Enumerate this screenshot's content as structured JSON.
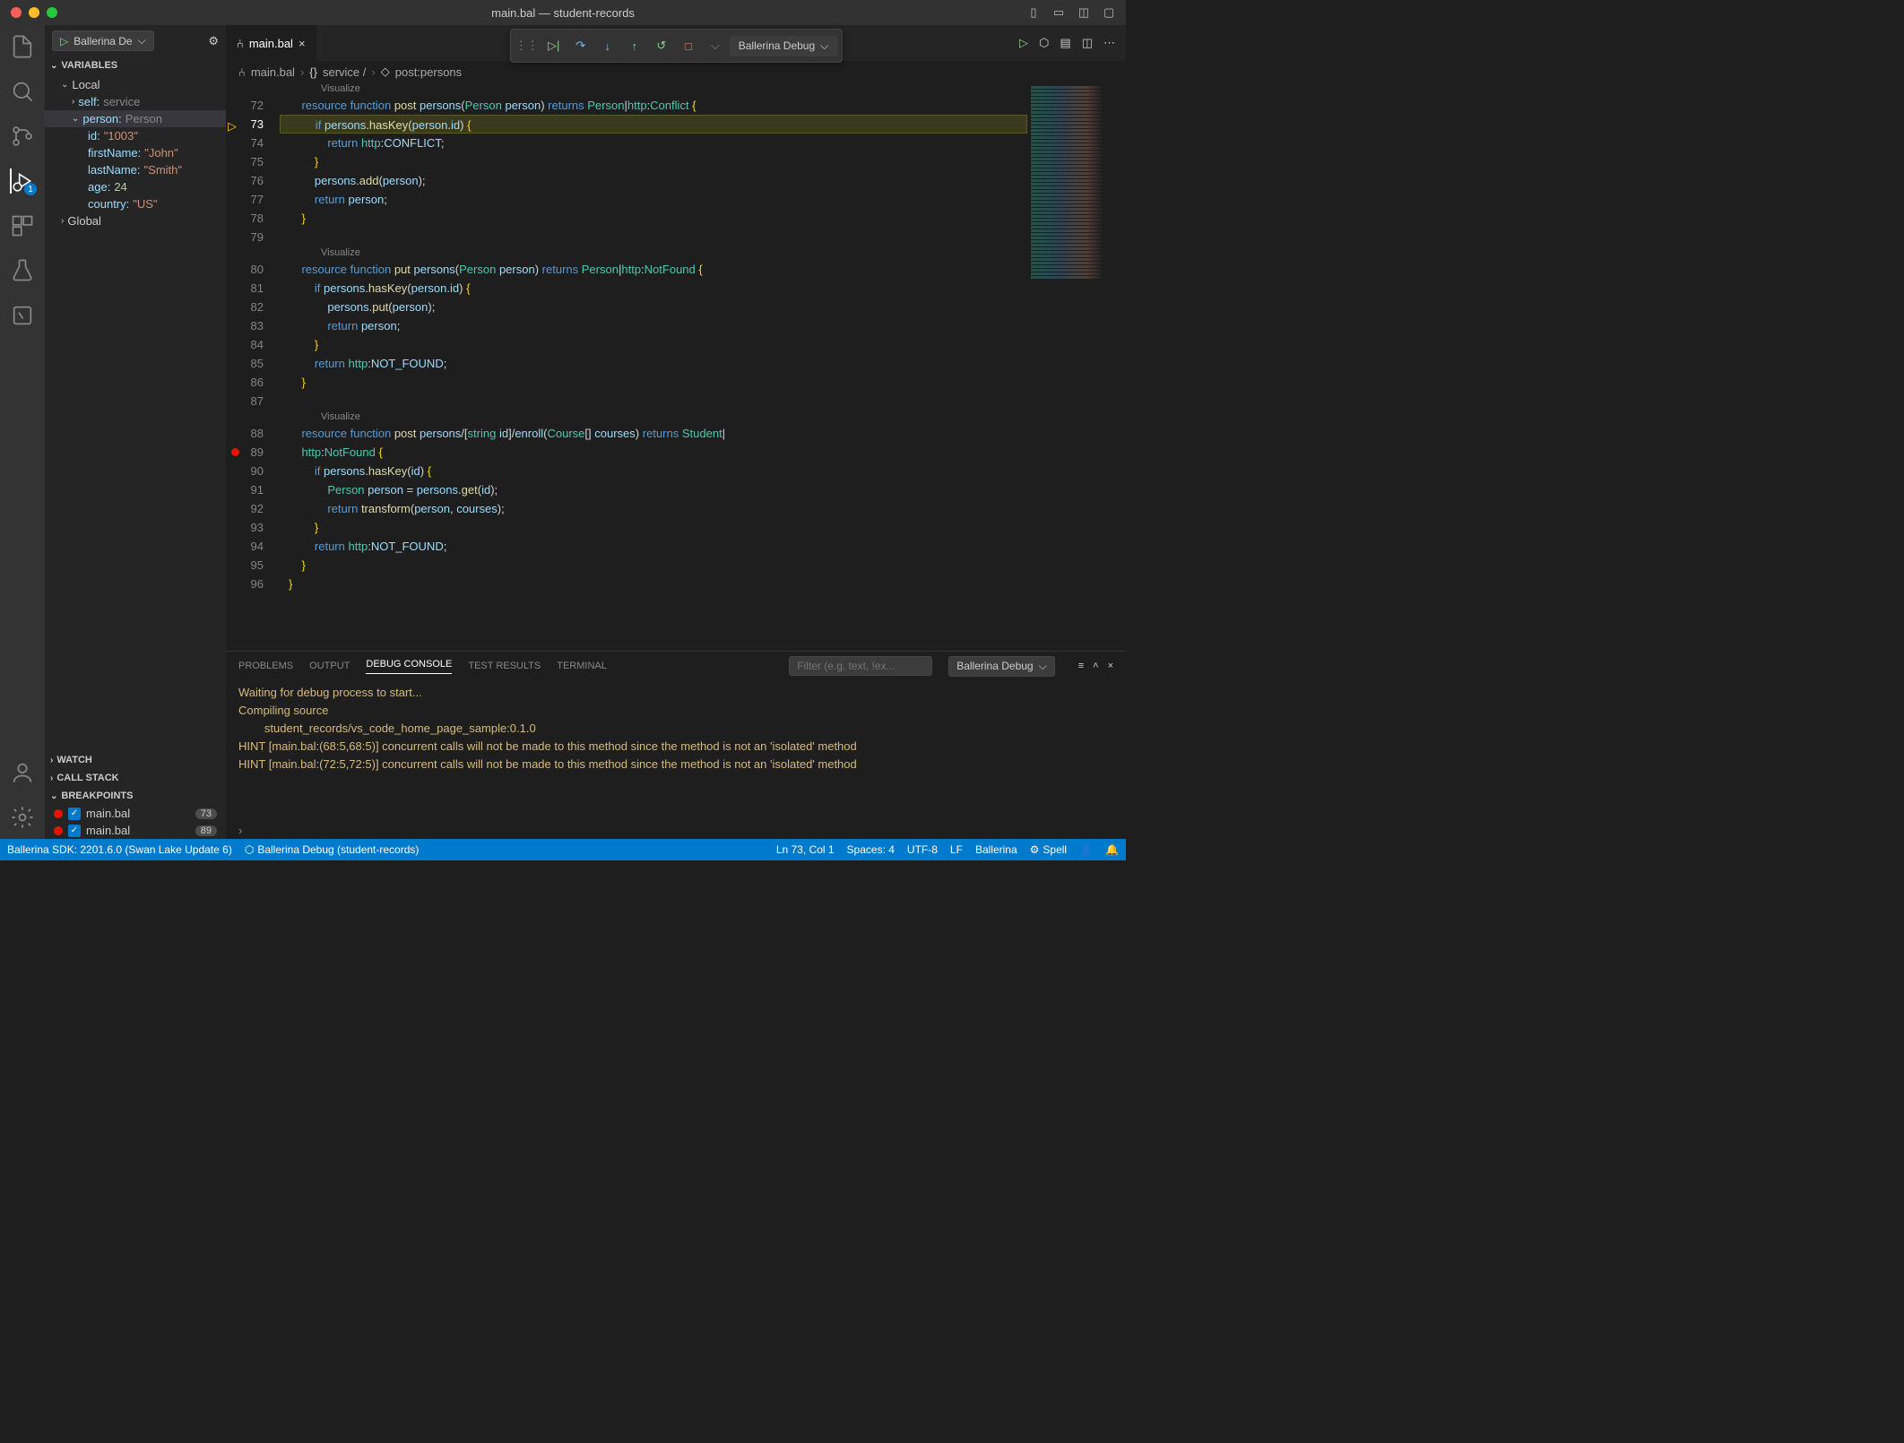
{
  "window": {
    "title": "main.bal — student-records"
  },
  "sidebar": {
    "debug_config": "Ballerina De",
    "sections": {
      "variables": "Variables",
      "watch": "Watch",
      "callstack": "Call Stack",
      "breakpoints": "Breakpoints"
    },
    "local_label": "Local",
    "vars": {
      "self": {
        "name": "self:",
        "type": "service"
      },
      "person": {
        "name": "person:",
        "type": "Person"
      },
      "id": {
        "name": "id:",
        "value": "\"1003\""
      },
      "firstName": {
        "name": "firstName:",
        "value": "\"John\""
      },
      "lastName": {
        "name": "lastName:",
        "value": "\"Smith\""
      },
      "age": {
        "name": "age:",
        "value": "24"
      },
      "country": {
        "name": "country:",
        "value": "\"US\""
      },
      "global": "Global"
    },
    "breakpoints": [
      {
        "file": "main.bal",
        "line": "73"
      },
      {
        "file": "main.bal",
        "line": "89"
      }
    ]
  },
  "tab": {
    "name": "main.bal"
  },
  "debug_toolbar": {
    "config": "Ballerina Debug"
  },
  "breadcrumb": {
    "file": "main.bal",
    "service": "service /",
    "fn": "post:persons"
  },
  "code": {
    "visualize": "Visualize",
    "lines": {
      "72": {
        "n": "72"
      },
      "73": {
        "n": "73"
      },
      "74": {
        "n": "74"
      },
      "75": {
        "n": "75"
      },
      "76": {
        "n": "76"
      },
      "77": {
        "n": "77"
      },
      "78": {
        "n": "78"
      },
      "79": {
        "n": "79"
      },
      "80": {
        "n": "80"
      },
      "81": {
        "n": "81"
      },
      "82": {
        "n": "82"
      },
      "83": {
        "n": "83"
      },
      "84": {
        "n": "84"
      },
      "85": {
        "n": "85"
      },
      "86": {
        "n": "86"
      },
      "87": {
        "n": "87"
      },
      "88": {
        "n": "88"
      },
      "89": {
        "n": "89"
      },
      "90": {
        "n": "90"
      },
      "91": {
        "n": "91"
      },
      "92": {
        "n": "92"
      },
      "93": {
        "n": "93"
      },
      "94": {
        "n": "94"
      },
      "95": {
        "n": "95"
      },
      "96": {
        "n": "96"
      }
    }
  },
  "panel": {
    "tabs": {
      "problems": "PROBLEMS",
      "output": "OUTPUT",
      "debug": "DEBUG CONSOLE",
      "tests": "TEST RESULTS",
      "terminal": "TERMINAL"
    },
    "filter_placeholder": "Filter (e.g. text, !ex...",
    "select": "Ballerina Debug",
    "console": [
      "Waiting for debug process to start...",
      "",
      "Compiling source",
      "        student_records/vs_code_home_page_sample:0.1.0",
      "HINT [main.bal:(68:5,68:5)] concurrent calls will not be made to this method since the method is not an 'isolated' method",
      "HINT [main.bal:(72:5,72:5)] concurrent calls will not be made to this method since the method is not an 'isolated' method"
    ]
  },
  "status": {
    "sdk": "Ballerina SDK: 2201.6.0 (Swan Lake Update 6)",
    "debug": "Ballerina Debug (student-records)",
    "pos": "Ln 73, Col 1",
    "spaces": "Spaces: 4",
    "encoding": "UTF-8",
    "eol": "LF",
    "lang": "Ballerina",
    "spell": "Spell"
  }
}
